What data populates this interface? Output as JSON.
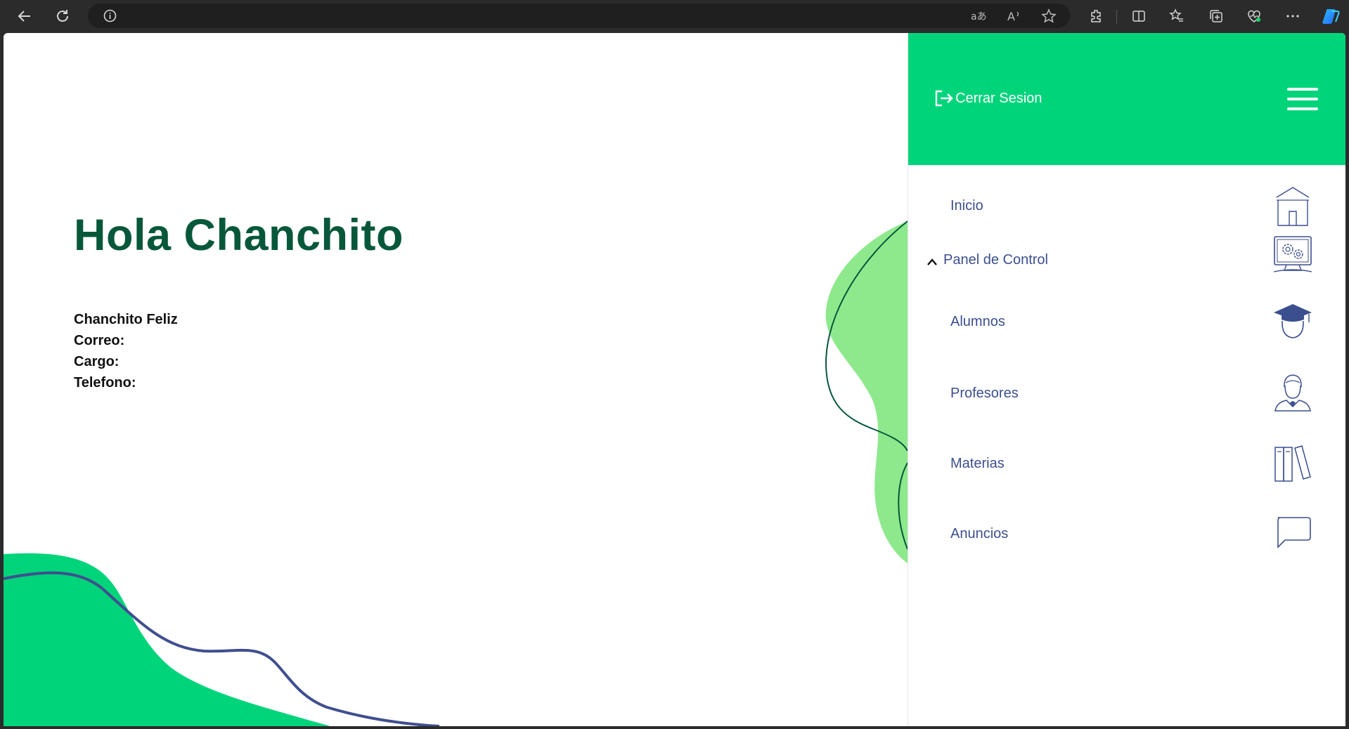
{
  "browser": {
    "icons": [
      "back-icon",
      "refresh-icon",
      "site-info-icon",
      "translate-icon",
      "read-aloud-icon",
      "favorite-star-icon",
      "extensions-icon",
      "split-screen-icon",
      "favorites-icon",
      "collections-icon",
      "browser-essentials-icon",
      "more-icon",
      "copilot-icon"
    ]
  },
  "main": {
    "greeting": "Hola Chanchito",
    "profile": {
      "name": "Chanchito Feliz",
      "email_label": "Correo:",
      "role_label": "Cargo:",
      "phone_label": "Telefono:"
    }
  },
  "menu": {
    "logout_label": "Cerrar Sesion",
    "items": [
      {
        "label": "Inicio",
        "icon": "home-icon"
      },
      {
        "label": "Panel de Control",
        "icon": "control-panel-icon",
        "expanded": true
      },
      {
        "label": "Alumnos",
        "icon": "student-icon"
      },
      {
        "label": "Profesores",
        "icon": "teacher-icon"
      },
      {
        "label": "Materias",
        "icon": "books-icon"
      },
      {
        "label": "Anuncios",
        "icon": "chat-bubble-icon"
      }
    ]
  },
  "colors": {
    "accent_green": "#00d47b",
    "light_green": "#8ee98d",
    "dark_green": "#07583a",
    "menu_text": "#3b4f8f",
    "curve_blue": "#3f4f8f"
  }
}
